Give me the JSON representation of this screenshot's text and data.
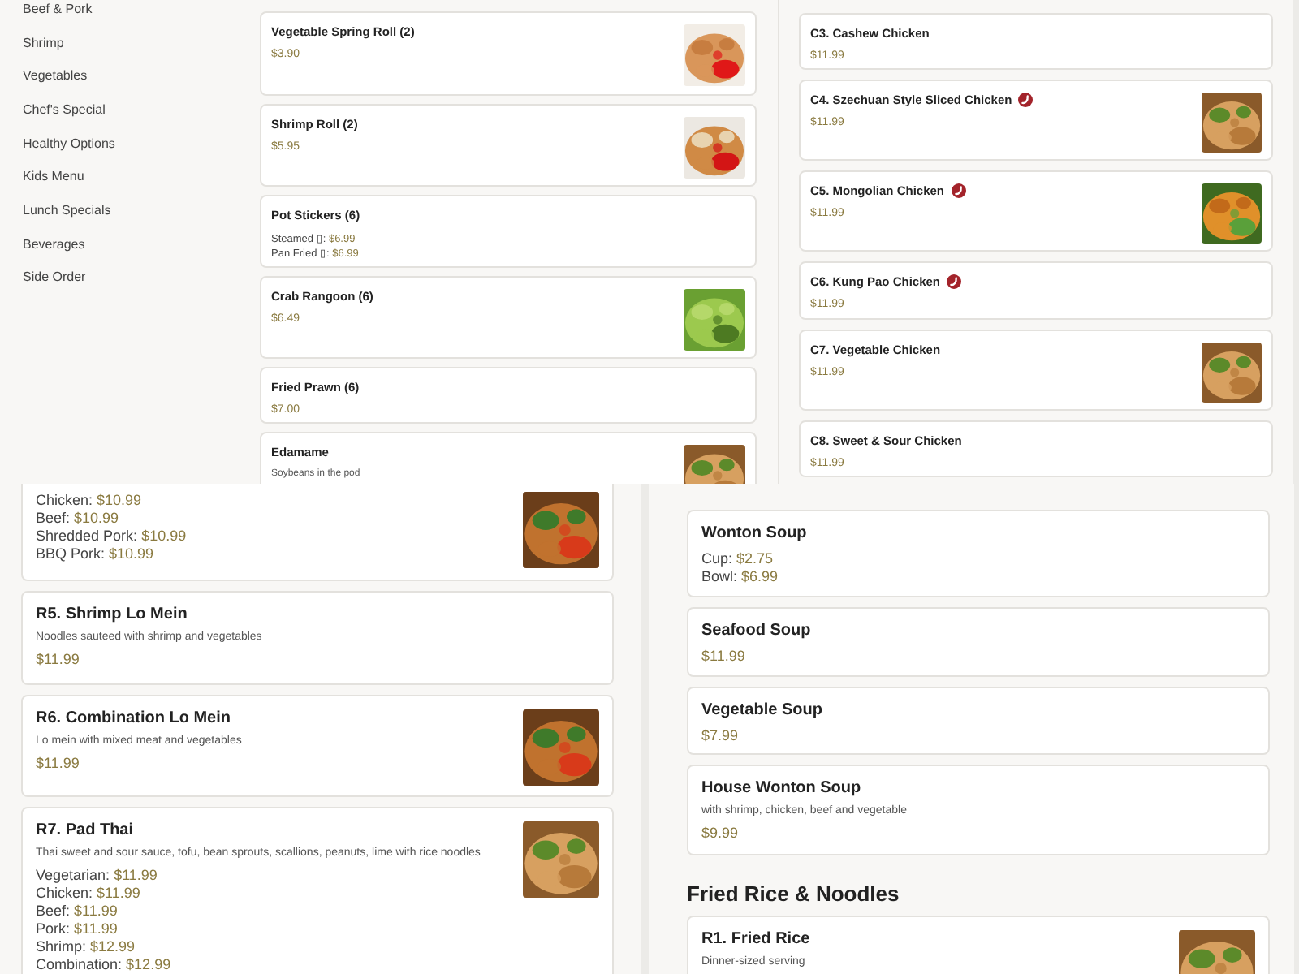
{
  "appetizers_view": {
    "categories": [
      {
        "label": "Beef & Pork"
      },
      {
        "label": "Shrimp"
      },
      {
        "label": "Vegetables"
      },
      {
        "label": "Chef's Special"
      },
      {
        "label": "Healthy Options"
      },
      {
        "label": "Kids Menu"
      },
      {
        "label": "Lunch Specials"
      },
      {
        "label": "Beverages"
      },
      {
        "label": "Side Order"
      }
    ],
    "items": [
      {
        "name": "Vegetable Spring Roll (2)",
        "price": "$3.90"
      },
      {
        "name": "Shrimp Roll (2)",
        "price": "$5.95"
      },
      {
        "name": "Pot Stickers (6)",
        "options": [
          {
            "label": "Steamed ▯:",
            "price": "$6.99"
          },
          {
            "label": "Pan Fried ▯:",
            "price": "$6.99"
          }
        ]
      },
      {
        "name": "Crab Rangoon (6)",
        "price": "$6.49"
      },
      {
        "name": "Fried Prawn (6)",
        "price": "$7.00"
      },
      {
        "name": "Edamame",
        "description": "Soybeans in the pod"
      }
    ]
  },
  "chicken_view": {
    "items": [
      {
        "name": "C3. Cashew Chicken",
        "price": "$11.99",
        "spicy": false
      },
      {
        "name": "C4. Szechuan Style Sliced Chicken",
        "price": "$11.99",
        "spicy": true
      },
      {
        "name": "C5. Mongolian Chicken",
        "price": "$11.99",
        "spicy": true
      },
      {
        "name": "C6. Kung Pao Chicken",
        "price": "$11.99",
        "spicy": true
      },
      {
        "name": "C7. Vegetable Chicken",
        "price": "$11.99",
        "spicy": false
      },
      {
        "name": "C8. Sweet & Sour Chicken",
        "price": "$11.99",
        "spicy": false
      }
    ]
  },
  "noodles_view": {
    "items": [
      {
        "options": [
          {
            "label": "Chicken:",
            "price": "$10.99"
          },
          {
            "label": "Beef:",
            "price": "$10.99"
          },
          {
            "label": "Shredded Pork:",
            "price": "$10.99"
          },
          {
            "label": "BBQ Pork:",
            "price": "$10.99"
          }
        ]
      },
      {
        "name": "R5. Shrimp Lo Mein",
        "description": "Noodles sauteed with shrimp and vegetables",
        "price": "$11.99"
      },
      {
        "name": "R6. Combination Lo Mein",
        "description": "Lo mein with mixed meat and vegetables",
        "price": "$11.99"
      },
      {
        "name": "R7. Pad Thai",
        "description": "Thai sweet and sour sauce, tofu, bean sprouts, scallions, peanuts, lime with rice noodles",
        "options": [
          {
            "label": "Vegetarian:",
            "price": "$11.99"
          },
          {
            "label": "Chicken:",
            "price": "$11.99"
          },
          {
            "label": "Beef:",
            "price": "$11.99"
          },
          {
            "label": "Pork:",
            "price": "$11.99"
          },
          {
            "label": "Shrimp:",
            "price": "$12.99"
          },
          {
            "label": "Combination:",
            "price": "$12.99"
          }
        ]
      }
    ]
  },
  "soups_view": {
    "items": [
      {
        "name": "Wonton Soup",
        "options": [
          {
            "label": "Cup:",
            "price": "$2.75"
          },
          {
            "label": "Bowl:",
            "price": "$6.99"
          }
        ]
      },
      {
        "name": "Seafood Soup",
        "price": "$11.99"
      },
      {
        "name": "Vegetable Soup",
        "price": "$7.99"
      },
      {
        "name": "House Wonton Soup",
        "description": "with shrimp, chicken, beef and vegetable",
        "price": "$9.99"
      }
    ],
    "section_title": "Fried Rice & Noodles",
    "section_items": [
      {
        "name": "R1. Fried Rice",
        "description": "Dinner-sized serving"
      }
    ]
  }
}
